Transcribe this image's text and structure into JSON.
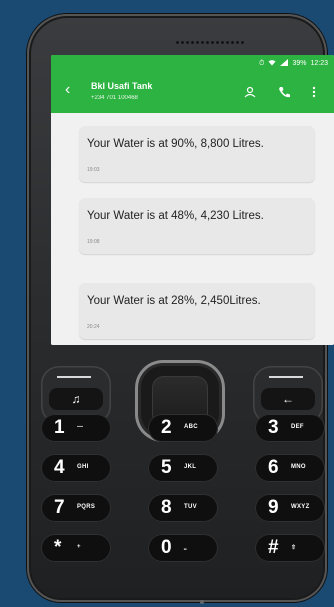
{
  "status_bar": {
    "icons": [
      "clock-icon",
      "wifi-icon",
      "signal-icon"
    ],
    "battery": "39%",
    "time": "12:23"
  },
  "contact": {
    "name": "Bkl Usafi Tank",
    "number": "+234 701 100468"
  },
  "messages": [
    {
      "text": "Your Water is at 90%, 8,800 Litres.",
      "time": "19:03"
    },
    {
      "text": "Your Water is at 48%, 4,230 Litres.",
      "time": "19:08"
    },
    {
      "text": "Your Water is at 28%,  2,450Litres.",
      "time": "20:24"
    }
  ],
  "keypad": {
    "keys": [
      {
        "d": "1",
        "l": ""
      },
      {
        "d": "2",
        "l": "ABC"
      },
      {
        "d": "3",
        "l": "DEF"
      },
      {
        "d": "4",
        "l": "GHI"
      },
      {
        "d": "5",
        "l": "JKL"
      },
      {
        "d": "6",
        "l": "MNO"
      },
      {
        "d": "7",
        "l": "PQRS"
      },
      {
        "d": "8",
        "l": "TUV"
      },
      {
        "d": "9",
        "l": "WXYZ"
      },
      {
        "d": "*",
        "l": "+"
      },
      {
        "d": "0",
        "l": ""
      },
      {
        "d": "#",
        "l": ""
      }
    ]
  },
  "colors": {
    "app_bar": "#2db341",
    "call": "#36b24a",
    "end": "#d22a2a",
    "background": "#1a4a72"
  }
}
